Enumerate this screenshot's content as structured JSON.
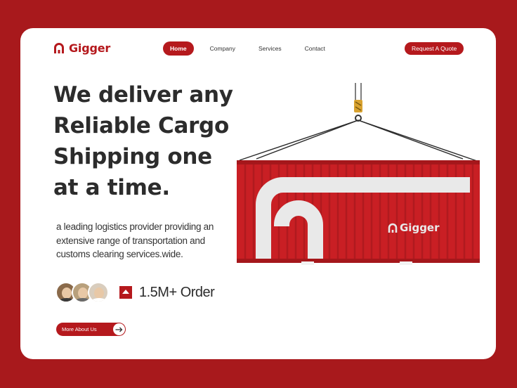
{
  "brand": {
    "name": "Gigger",
    "accent": "#B5191D",
    "background": "#A8191C"
  },
  "nav": {
    "items": [
      {
        "label": "Home",
        "active": true
      },
      {
        "label": "Company",
        "active": false
      },
      {
        "label": "Services",
        "active": false
      },
      {
        "label": "Contact",
        "active": false
      }
    ],
    "cta": "Request A Quote"
  },
  "hero": {
    "headline_lines": [
      "We deliver any",
      "Reliable Cargo",
      "Shipping one",
      "at a time."
    ],
    "description": "a leading logistics provider providing an extensive range of transportation and customs clearing services.wide.",
    "stat": "1.5M+ Order",
    "stat_icon": "order-icon",
    "button": "More About Us",
    "container_brand": "Gigger"
  }
}
